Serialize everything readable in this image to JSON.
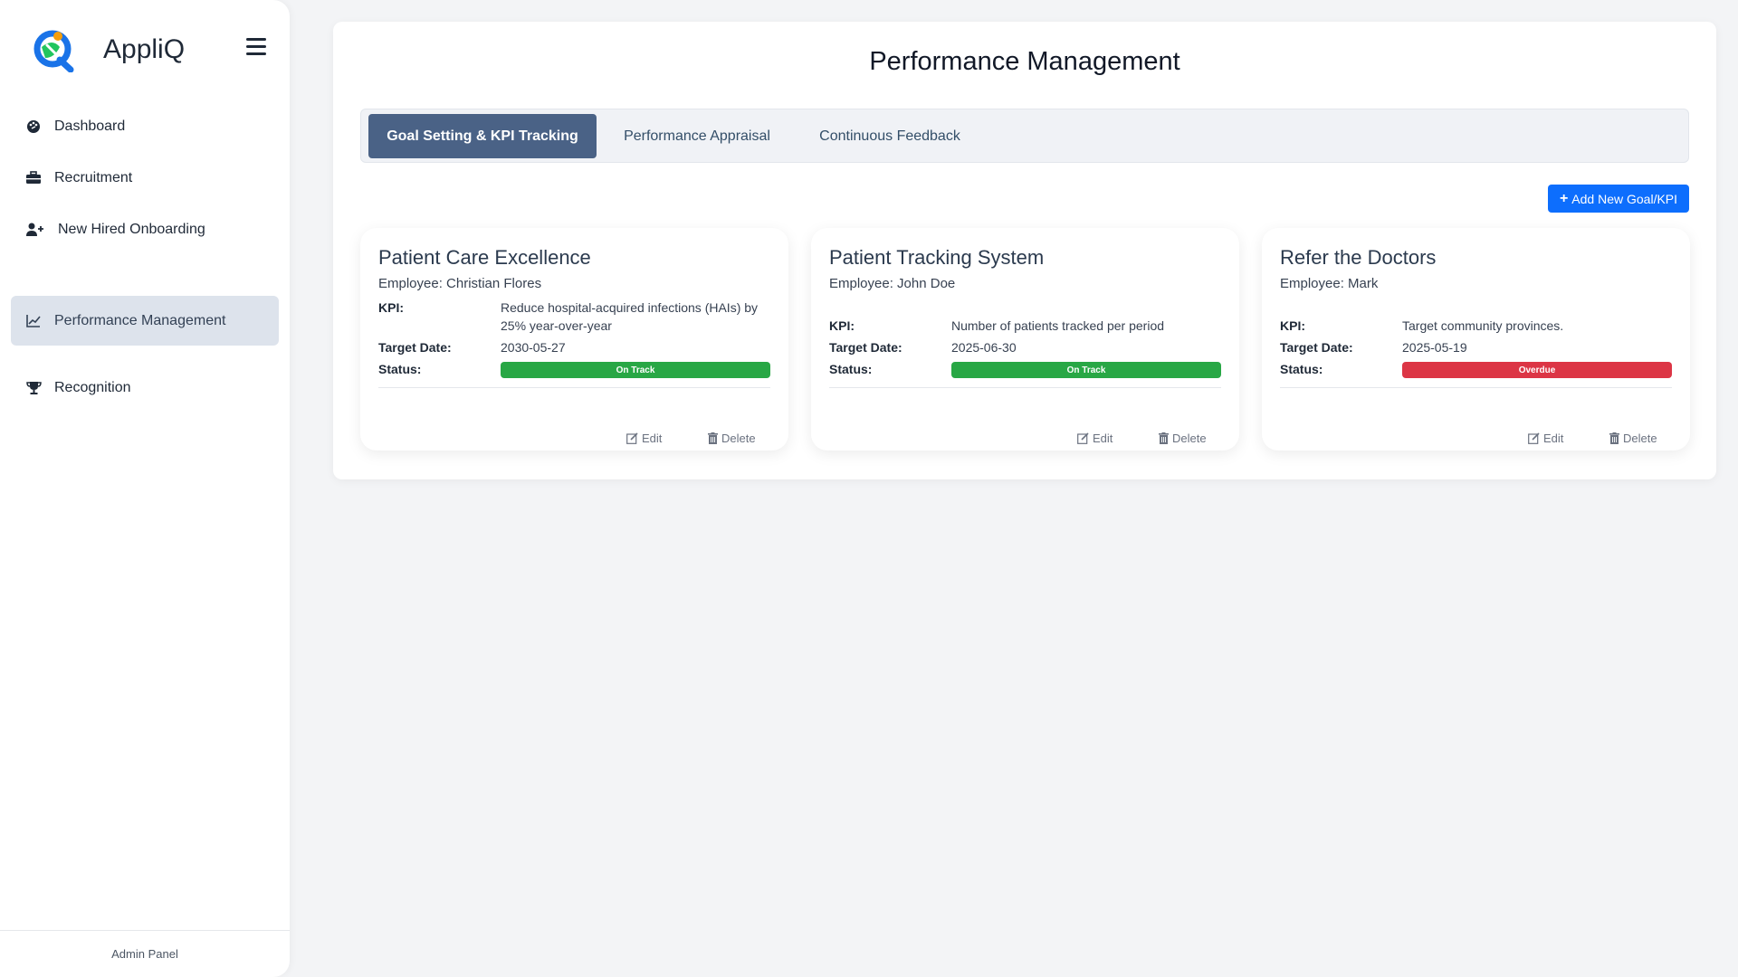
{
  "app": {
    "name": "AppliQ"
  },
  "sidebar": {
    "items": [
      {
        "label": "Dashboard",
        "icon": "palette-icon"
      },
      {
        "label": "Recruitment",
        "icon": "briefcase-icon"
      },
      {
        "label": "New Hired Onboarding",
        "icon": "user-plus-icon"
      },
      {
        "label": "Performance Management",
        "icon": "chart-line-icon",
        "active": true
      },
      {
        "label": "Recognition",
        "icon": "trophy-icon"
      }
    ],
    "footer": "Admin Panel"
  },
  "main": {
    "title": "Performance Management",
    "tabs": [
      {
        "label": "Goal Setting & KPI Tracking",
        "active": true
      },
      {
        "label": "Performance Appraisal"
      },
      {
        "label": "Continuous Feedback"
      }
    ],
    "add_button": "Add New Goal/KPI",
    "labels": {
      "kpi": "KPI:",
      "target_date": "Target Date:",
      "status": "Status:",
      "edit": "Edit",
      "delete": "Delete"
    },
    "goals": [
      {
        "title": "Patient Care Excellence",
        "employee": "Employee: Christian Flores",
        "kpi": "Reduce hospital-acquired infections (HAIs) by 25% year-over-year",
        "target_date": "2030-05-27",
        "status": "On Track",
        "status_color": "#28a745"
      },
      {
        "title": "Patient Tracking System",
        "employee": "Employee: John Doe",
        "kpi": "Number of patients tracked per period",
        "target_date": "2025-06-30",
        "status": "On Track",
        "status_color": "#28a745"
      },
      {
        "title": "Refer the Doctors",
        "employee": "Employee: Mark",
        "kpi": "Target community provinces.",
        "target_date": "2025-05-19",
        "status": "Overdue",
        "status_color": "#dc3545"
      }
    ]
  },
  "colors": {
    "accent": "#0d6efd",
    "active_tab": "#4a6286",
    "active_nav": "#dde3ec"
  }
}
